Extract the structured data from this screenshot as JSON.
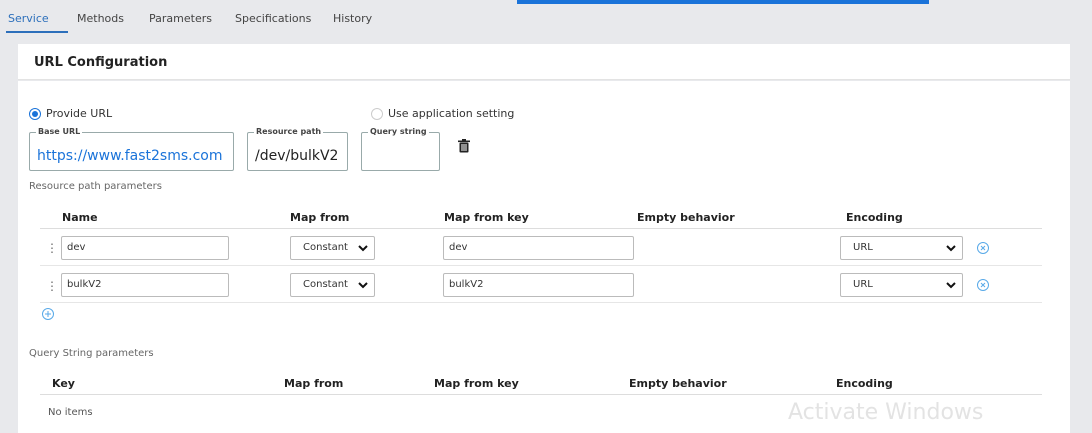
{
  "tabs": [
    {
      "label": "Service",
      "active": true
    },
    {
      "label": "Methods"
    },
    {
      "label": "Parameters"
    },
    {
      "label": "Specifications"
    },
    {
      "label": "History"
    }
  ],
  "card": {
    "title": "URL Configuration"
  },
  "url_options": {
    "provide_url": {
      "label": "Provide URL",
      "checked": true
    },
    "use_app_setting": {
      "label": "Use application setting",
      "checked": false
    }
  },
  "base_url": {
    "legend": "Base URL",
    "value": "https://www.fast2sms.com"
  },
  "resource_path": {
    "legend": "Resource path",
    "value": "/dev/bulkV2"
  },
  "query_string": {
    "legend": "Query string",
    "value": ""
  },
  "resource_params": {
    "label": "Resource path parameters",
    "headers": {
      "name": "Name",
      "map_from": "Map from",
      "map_from_key": "Map from key",
      "empty_behavior": "Empty behavior",
      "encoding": "Encoding"
    },
    "rows": [
      {
        "name": "dev",
        "map_from": "Constant",
        "map_from_key": "dev",
        "encoding": "URL"
      },
      {
        "name": "bulkV2",
        "map_from": "Constant",
        "map_from_key": "bulkV2",
        "encoding": "URL"
      }
    ]
  },
  "query_params": {
    "label": "Query String parameters",
    "headers": {
      "key": "Key",
      "map_from": "Map from",
      "map_from_key": "Map from key",
      "empty_behavior": "Empty behavior",
      "encoding": "Encoding"
    },
    "empty_text": "No items"
  },
  "watermark": "Activate Windows",
  "colors": {
    "accent": "#1a73d9",
    "tab_active": "#2c6fbb",
    "link": "#1a73d9",
    "remove_icon": "#58a9e8"
  },
  "icons": [
    "trash-icon",
    "grip-icon",
    "chevron-down-icon",
    "remove-circle-icon",
    "add-circle-icon"
  ]
}
